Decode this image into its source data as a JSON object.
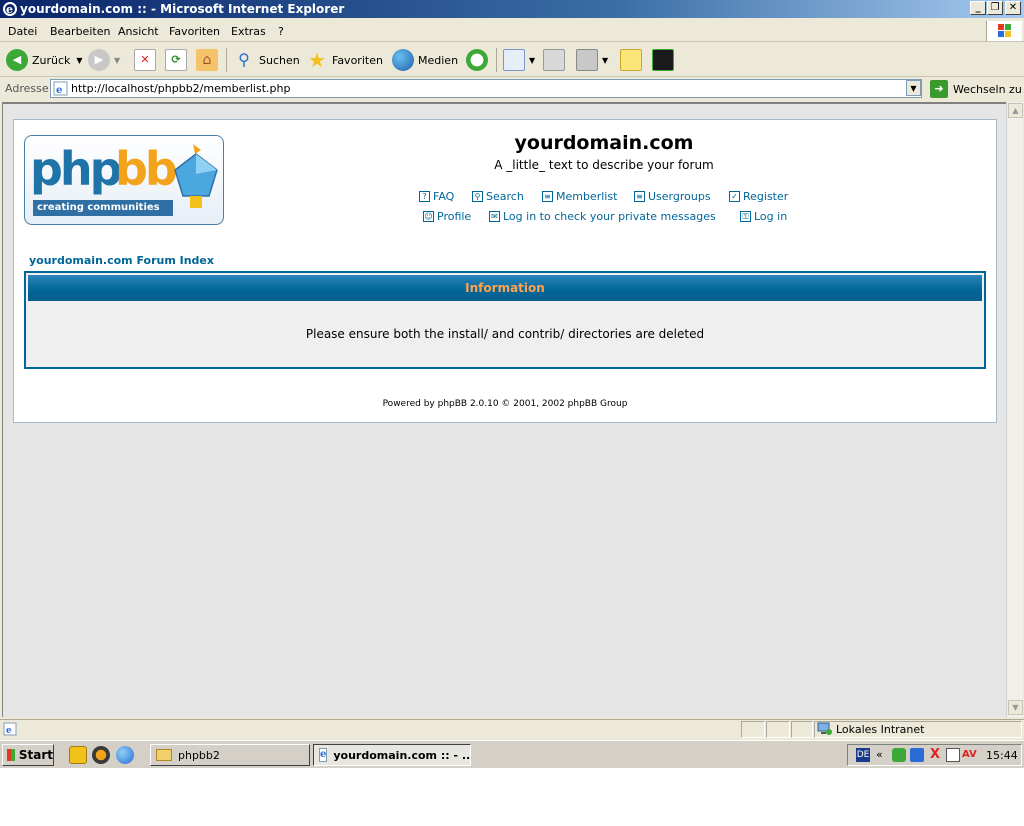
{
  "window": {
    "title": "yourdomain.com :: - Microsoft Internet Explorer"
  },
  "menu": [
    "Datei",
    "Bearbeiten",
    "Ansicht",
    "Favoriten",
    "Extras",
    "?"
  ],
  "toolbar": {
    "back_label": "Zurück",
    "search_label": "Suchen",
    "favorites_label": "Favoriten",
    "media_label": "Medien"
  },
  "address": {
    "label": "Adresse",
    "url": "http://localhost/phpbb2/memberlist.php",
    "go_label": "Wechseln zu"
  },
  "page": {
    "logo_php": "php",
    "logo_bb": "bb",
    "logo_tagline": "creating communities",
    "site_title": "yourdomain.com",
    "site_description": "A _little_ text to describe your forum",
    "nav": {
      "faq": "FAQ",
      "search": "Search",
      "memberlist": "Memberlist",
      "usergroups": "Usergroups",
      "register": "Register",
      "profile": "Profile",
      "private_messages": "Log in to check your private messages",
      "login": "Log in"
    },
    "forum_index": "yourdomain.com Forum Index",
    "info_title": "Information",
    "info_message": "Please ensure both the install/ and contrib/ directories are deleted",
    "powered_by": "Powered by phpBB 2.0.10 © 2001, 2002 phpBB Group"
  },
  "statusbar": {
    "zone": "Lokales Intranet"
  },
  "taskbar": {
    "start_label": "Start",
    "task1": "phpbb2",
    "task2": "yourdomain.com :: - ...",
    "lang": "DE",
    "clock": "15:44"
  },
  "colors": {
    "link": "#006699",
    "header_text": "#ffa34f",
    "title_bar": "#0a246a"
  }
}
